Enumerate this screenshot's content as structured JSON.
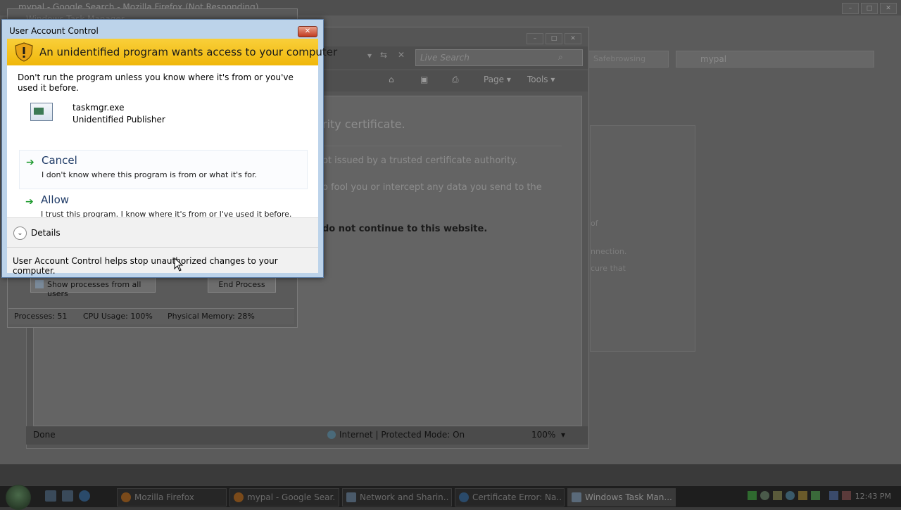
{
  "firefox": {
    "title": "mypal - Google Search - Mozilla Firefox (Not Responding)",
    "search_value": "mypal",
    "addr_right": "Safebrowsing",
    "side_text_1": "of",
    "side_text_2": "nnection.",
    "side_text_3": "cure that"
  },
  "ie": {
    "search_placeholder": "Live Search",
    "menu_page": "Page",
    "menu_tools": "Tools",
    "heading": "rity certificate.",
    "line1": "ot issued by a trusted certificate authority.",
    "line2": "o fool you or intercept any data you send to the",
    "line3": "do not continue to this website.",
    "status_done": "Done",
    "status_zone": "Internet | Protected Mode: On",
    "zoom": "100%"
  },
  "taskmgr": {
    "title": "Windows Task Manager",
    "show_all_button": "Show processes from all users",
    "end_process_button": "End Process",
    "processes": "Processes: 51",
    "cpu": "CPU Usage: 100%",
    "memory": "Physical Memory: 28%"
  },
  "uac": {
    "title": "User Account Control",
    "close_label": "✕",
    "headline": "An unidentified program wants access to your computer",
    "warning": "Don't run the program unless you know where it's from or you've used it before.",
    "program_name": "taskmgr.exe",
    "publisher": "Unidentified Publisher",
    "cancel_label": "Cancel",
    "cancel_desc": "I don't know where this program is from or what it's for.",
    "allow_label": "Allow",
    "allow_desc": "I trust this program. I know where it's from or I've used it before.",
    "details_label": "Details",
    "footer": "User Account Control helps stop unauthorized changes to your computer.",
    "shield_color": "#e8a317",
    "banner_color": "#f5c21c"
  },
  "taskbar": {
    "items": [
      {
        "label": "Mozilla Firefox",
        "icon": "firefox-icon"
      },
      {
        "label": "mypal - Google Sear...",
        "icon": "firefox-icon"
      },
      {
        "label": "Network and Sharin...",
        "icon": "network-icon"
      },
      {
        "label": "Certificate Error: Na...",
        "icon": "ie-icon"
      },
      {
        "label": "Windows Task Man...",
        "icon": "taskmgr-icon"
      }
    ],
    "clock": "12:43 PM"
  }
}
